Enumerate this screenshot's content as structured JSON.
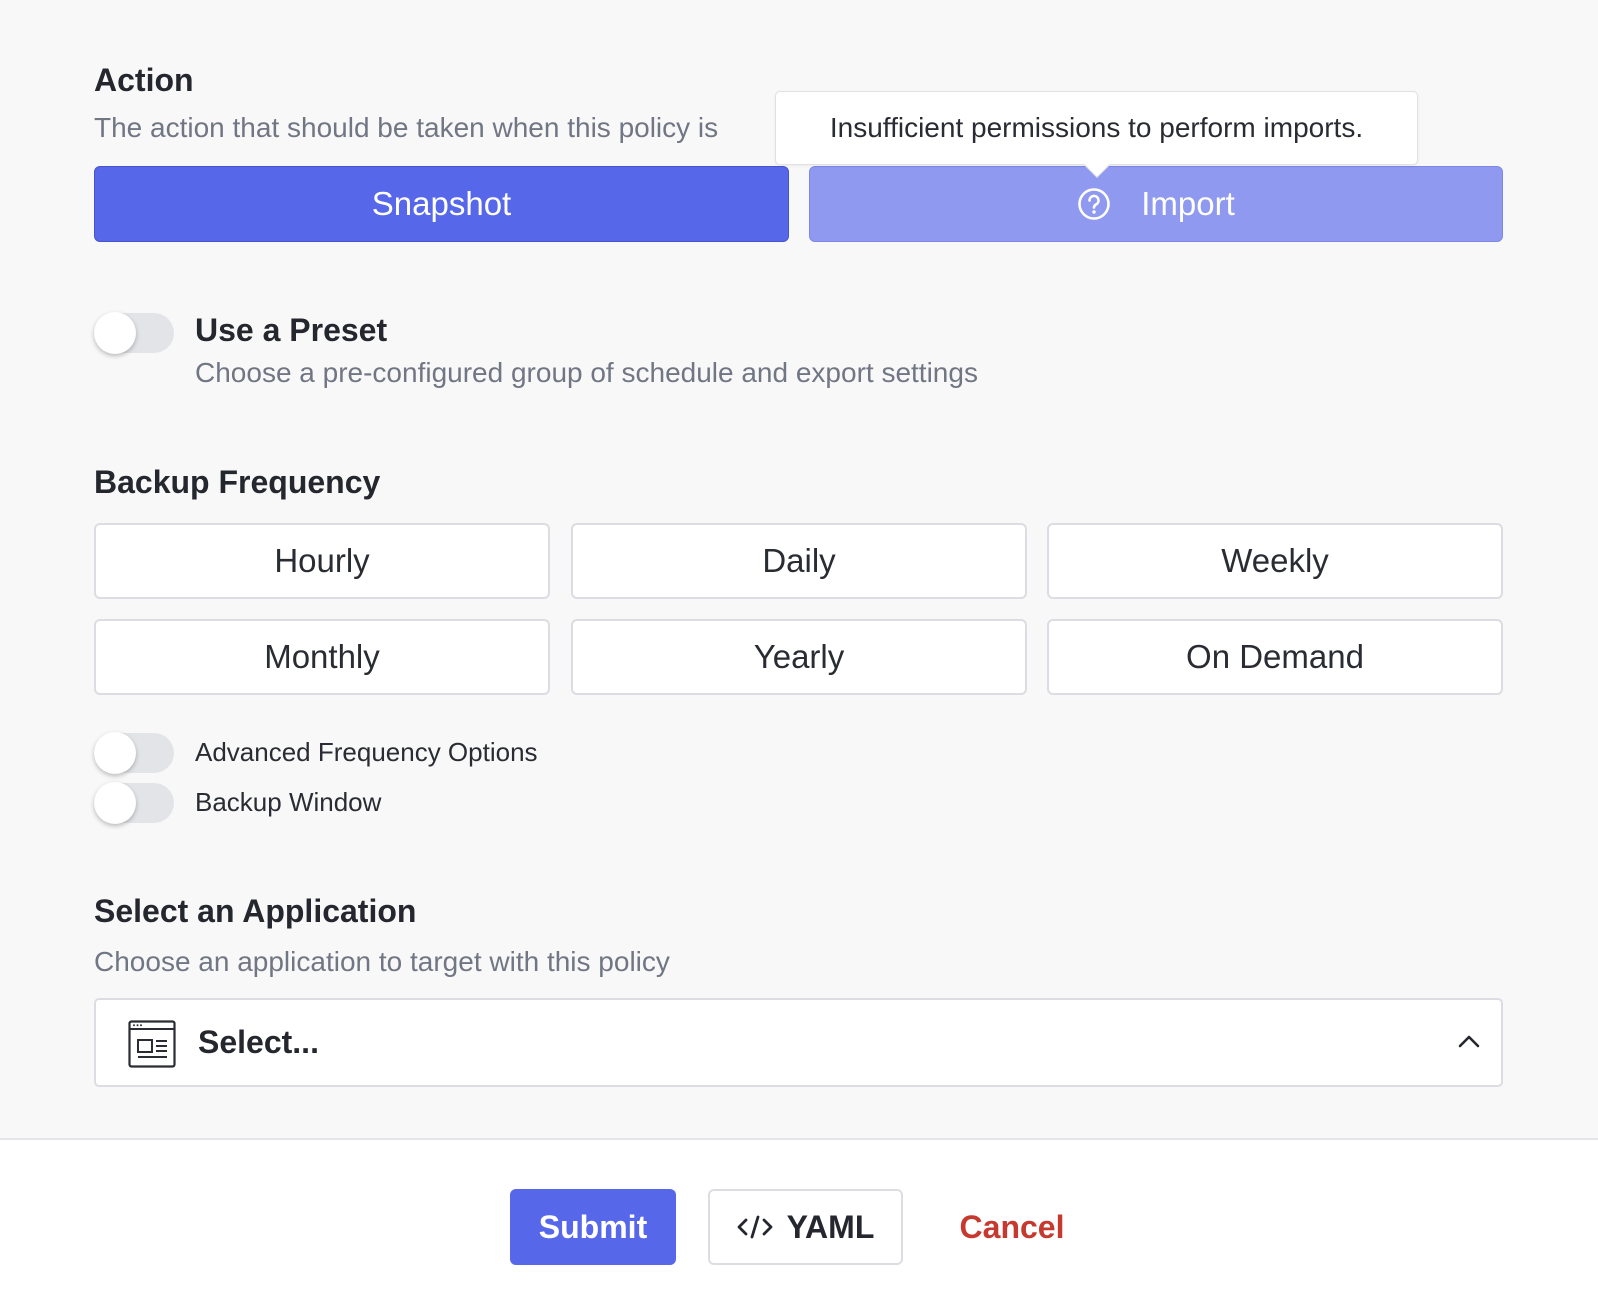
{
  "action": {
    "title": "Action",
    "description": "The action that should be taken when this policy is",
    "snapshot_label": "Snapshot",
    "import_label": "Import",
    "import_icon": "question-circle-icon",
    "tooltip": "Insufficient permissions to perform imports."
  },
  "preset": {
    "title": "Use a Preset",
    "description": "Choose a pre-configured group of schedule and export settings",
    "enabled": false
  },
  "frequency": {
    "title": "Backup Frequency",
    "options": [
      "Hourly",
      "Daily",
      "Weekly",
      "Monthly",
      "Yearly",
      "On Demand"
    ],
    "advanced_label": "Advanced Frequency Options",
    "window_label": "Backup Window"
  },
  "application": {
    "title": "Select an Application",
    "description": "Choose an application to target with this policy",
    "select_placeholder": "Select...",
    "select_icon": "application-window-icon",
    "chevron_icon": "chevron-up-icon"
  },
  "footer": {
    "submit_label": "Submit",
    "yaml_label": "YAML",
    "yaml_icon": "code-icon",
    "cancel_label": "Cancel"
  },
  "colors": {
    "primary": "#5667ea",
    "primary_disabled": "#8f99ef",
    "danger": "#c6392f"
  }
}
